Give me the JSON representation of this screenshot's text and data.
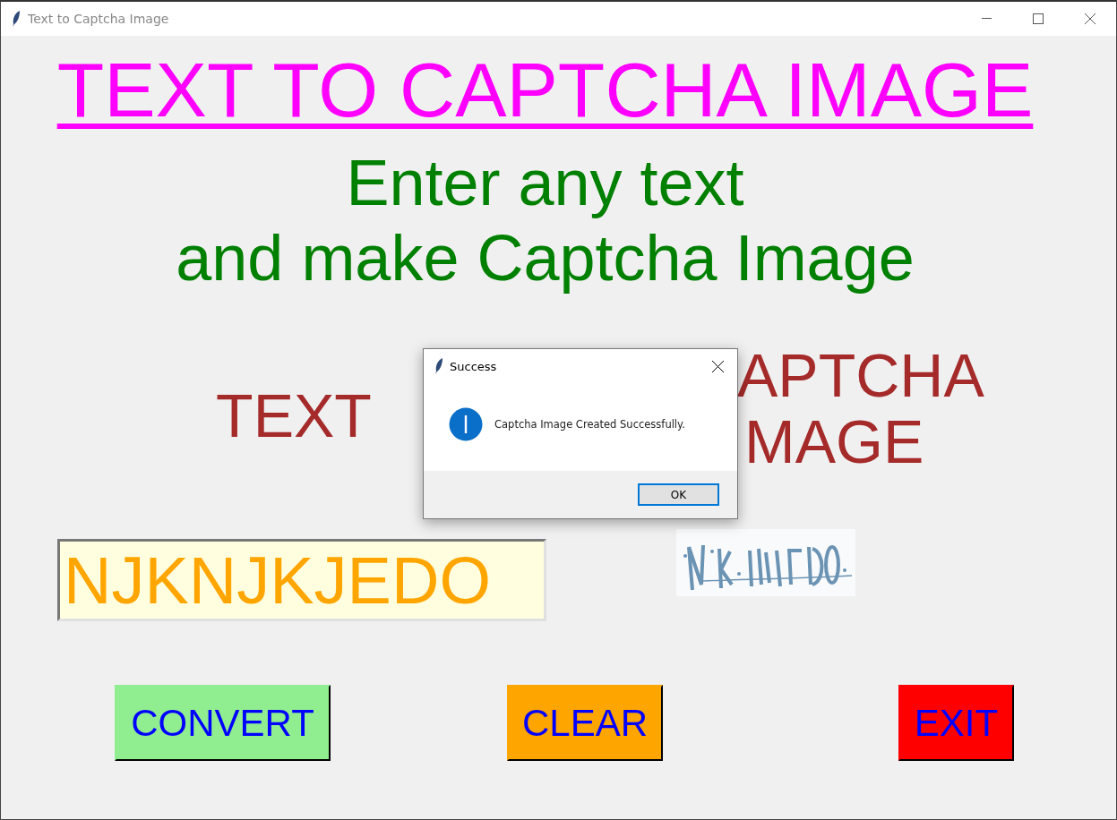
{
  "window": {
    "title": "Text to Captcha Image"
  },
  "heading": "TEXT TO CAPTCHA IMAGE",
  "subtitle": [
    "Enter any text",
    "and make Captcha Image"
  ],
  "text_label": "TEXT",
  "captcha_label": [
    "APTCHA",
    "MAGE"
  ],
  "text_entry": {
    "value": "NJKNJKJEDO"
  },
  "captcha_image": {
    "kind": "picture"
  },
  "buttons": [
    {
      "label": "CONVERT",
      "color": "#90ee90"
    },
    {
      "label": "CLEAR",
      "color": "#ffa500"
    },
    {
      "label": "EXIT",
      "color": "#ff0000"
    }
  ],
  "dialog": {
    "title": "Success",
    "message": "Captcha Image Created Successfully.",
    "button": "OK"
  }
}
